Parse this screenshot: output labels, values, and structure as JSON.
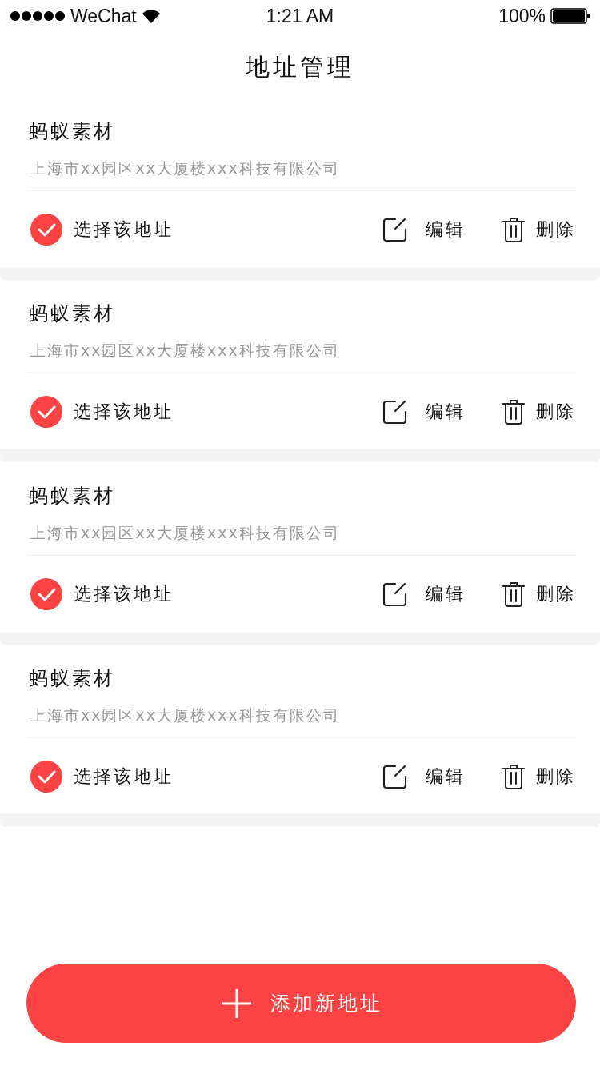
{
  "status_bar": {
    "carrier": "WeChat",
    "time": "1:21 AM",
    "battery": "100%"
  },
  "title": "地址管理",
  "addresses": [
    {
      "name": "蚂蚁素材",
      "address": "上海市xx园区xx大厦楼xxx科技有限公司",
      "select_label": "选择该地址",
      "checked": true,
      "edit_label": "编辑",
      "delete_label": "删除"
    },
    {
      "name": "蚂蚁素材",
      "address": "上海市xx园区xx大厦楼xxx科技有限公司",
      "select_label": "选择该地址",
      "checked": true,
      "edit_label": "编辑",
      "delete_label": "删除"
    },
    {
      "name": "蚂蚁素材",
      "address": "上海市xx园区xx大厦楼xxx科技有限公司",
      "select_label": "选择该地址",
      "checked": true,
      "edit_label": "编辑",
      "delete_label": "删除"
    },
    {
      "name": "蚂蚁素材",
      "address": "上海市xx园区xx大厦楼xxx科技有限公司",
      "select_label": "选择该地址",
      "checked": true,
      "edit_label": "编辑",
      "delete_label": "删除"
    }
  ],
  "add_button": {
    "label": "添加新地址"
  }
}
